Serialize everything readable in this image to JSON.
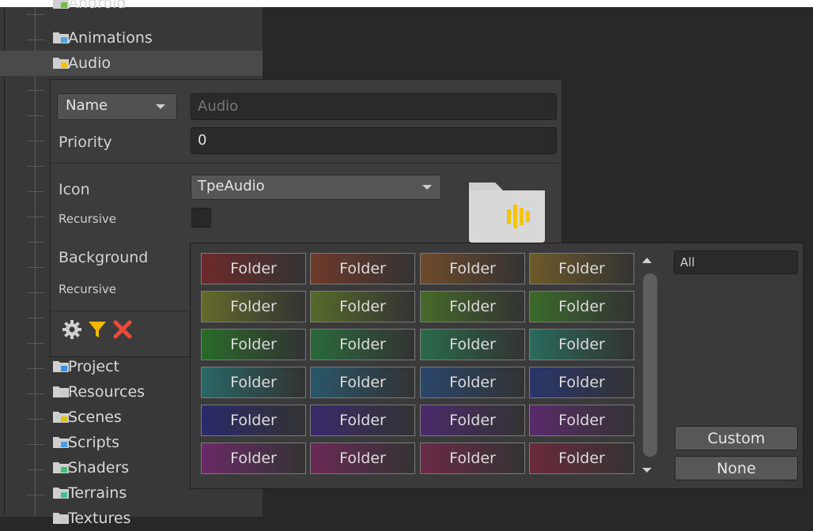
{
  "tree": {
    "items": [
      {
        "label": "Android",
        "icon": "android-folder-icon",
        "accent": "#6fbf3f"
      },
      {
        "label": "Animations",
        "icon": "animation-folder-icon",
        "accent": "#4fa3e0"
      },
      {
        "label": "Audio",
        "icon": "audio-folder-icon",
        "accent": "#f5c400",
        "selected": true
      },
      {
        "label": "Project",
        "icon": "project-folder-icon",
        "accent": "#3a8ee6"
      },
      {
        "label": "Resources",
        "icon": "resources-folder-icon",
        "accent": "#c8c8c8"
      },
      {
        "label": "Scenes",
        "icon": "scenes-folder-icon",
        "accent": "#e6c200"
      },
      {
        "label": "Scripts",
        "icon": "scripts-folder-icon",
        "accent": "#4aa0e6"
      },
      {
        "label": "Shaders",
        "icon": "shaders-folder-icon",
        "accent": "#3fbf6f"
      },
      {
        "label": "Terrains",
        "icon": "terrains-folder-icon",
        "accent": "#3fbf8f"
      },
      {
        "label": "Textures",
        "icon": "textures-folder-icon",
        "accent": "#c8c8c8"
      }
    ]
  },
  "settings": {
    "match_mode": "Name",
    "name_value": "Audio",
    "priority_label": "Priority",
    "priority_value": "0",
    "icon_label": "Icon",
    "icon_value": "TpeAudio",
    "icon_recursive_label": "Recursive",
    "background_label": "Background",
    "background_recursive_label": "Recursive",
    "toolbar": {
      "settings_icon": "gear-icon",
      "filter_icon": "filter-icon",
      "delete_icon": "close-icon"
    }
  },
  "palette": {
    "swatch_label": "Folder",
    "filter_value": "All",
    "custom_label": "Custom",
    "none_label": "None",
    "colors": [
      [
        "#6e2a2a",
        "#6e3a2a",
        "#6e4a2a",
        "#6e5a2a"
      ],
      [
        "#646a2a",
        "#566a2a",
        "#466a2a",
        "#3a6a2a"
      ],
      [
        "#2a6a2a",
        "#2a6a3a",
        "#2a6a4a",
        "#2a6a5a"
      ],
      [
        "#2a6666",
        "#2a566a",
        "#2a466a",
        "#2a366a"
      ],
      [
        "#2a2a6a",
        "#3a2a6a",
        "#4a2a6a",
        "#5a2a6a"
      ],
      [
        "#6a2a66",
        "#6a2a56",
        "#6a2a46",
        "#6a2a3a"
      ]
    ]
  }
}
